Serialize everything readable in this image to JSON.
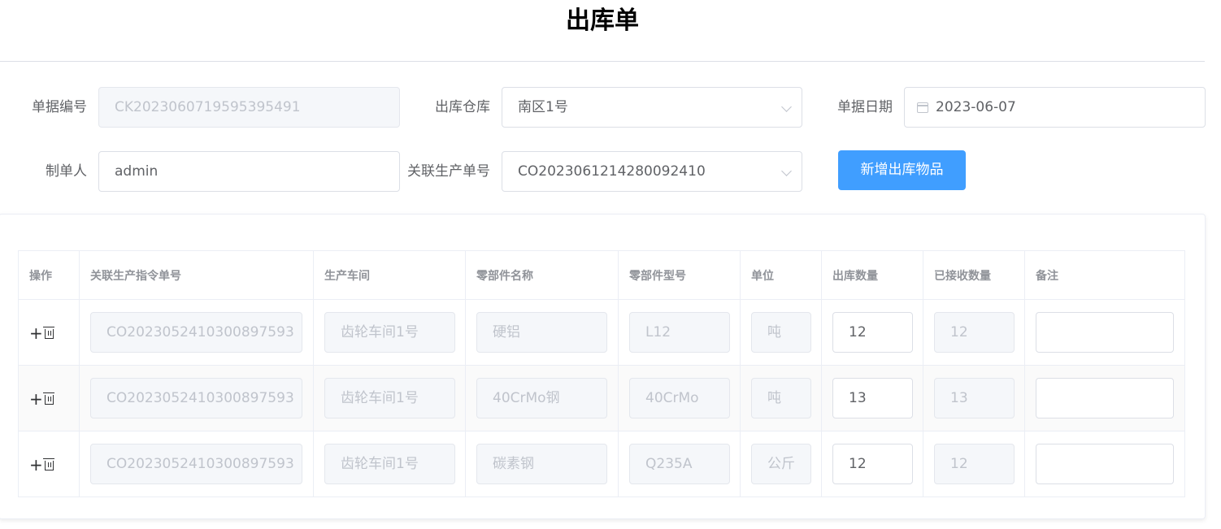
{
  "page": {
    "title": "出库单"
  },
  "form": {
    "doc_no": {
      "label": "单据编号",
      "value": "CK2023060719595395491"
    },
    "warehouse": {
      "label": "出库仓库",
      "value": "南区1号"
    },
    "doc_date": {
      "label": "单据日期",
      "value": "2023-06-07"
    },
    "creator": {
      "label": "制单人",
      "value": "admin"
    },
    "production_order": {
      "label": "关联生产单号",
      "value": "CO2023061214280092410"
    },
    "add_button": "新增出库物品"
  },
  "table": {
    "headers": [
      "操作",
      "关联生产指令单号",
      "生产车间",
      "零部件名称",
      "零部件型号",
      "单位",
      "出库数量",
      "已接收数量",
      "备注"
    ],
    "ops": {
      "add_glyph": "+"
    },
    "rows": [
      {
        "order_no": "CO2023052410300897593",
        "workshop": "齿轮车间1号",
        "part_name": "硬铝",
        "part_model": "L12",
        "unit": "吨",
        "out_qty": "12",
        "received_qty": "12",
        "remark": ""
      },
      {
        "order_no": "CO2023052410300897593",
        "workshop": "齿轮车间1号",
        "part_name": "40CrMo钢",
        "part_model": "40CrMo",
        "unit": "吨",
        "out_qty": "13",
        "received_qty": "13",
        "remark": ""
      },
      {
        "order_no": "CO2023052410300897593",
        "workshop": "齿轮车间1号",
        "part_name": "碳素钢",
        "part_model": "Q235A",
        "unit": "公斤",
        "out_qty": "12",
        "received_qty": "12",
        "remark": ""
      }
    ]
  },
  "colors": {
    "primary": "#409eff",
    "disabled_bg": "#f5f7fa",
    "border": "#dcdfe6"
  }
}
